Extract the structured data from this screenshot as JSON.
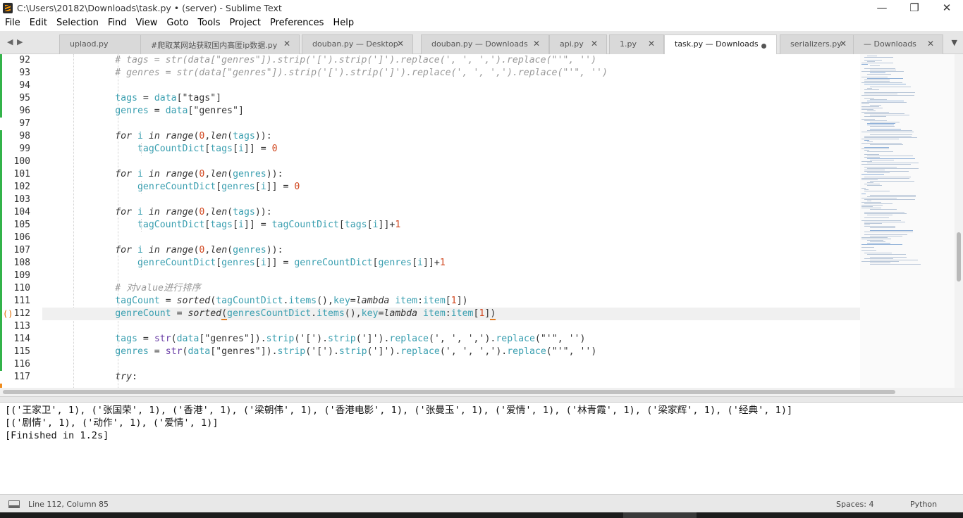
{
  "window": {
    "title": "C:\\Users\\20182\\Downloads\\task.py • (server) - Sublime Text",
    "min_icon": "minimize-icon",
    "max_icon": "maximize-icon",
    "close_icon": "close-icon"
  },
  "menu": [
    "File",
    "Edit",
    "Selection",
    "Find",
    "View",
    "Goto",
    "Tools",
    "Project",
    "Preferences",
    "Help"
  ],
  "tabs": [
    {
      "label": "uplaod.py",
      "active": false
    },
    {
      "label": "#爬取某网站获取国内高匿ip数据.py",
      "active": false
    },
    {
      "label": "douban.py — Desktop",
      "active": false
    },
    {
      "label": "douban.py — Downloads",
      "active": false
    },
    {
      "label": "api.py",
      "active": false
    },
    {
      "label": "1.py",
      "active": false
    },
    {
      "label": "task.py — Downloads",
      "active": true
    },
    {
      "label": "serializers.py",
      "active": false
    },
    {
      "label": "— Downloads",
      "active": false
    }
  ],
  "editor": {
    "line_numbers": [
      "92",
      "93",
      "94",
      "95",
      "96",
      "97",
      "98",
      "99",
      "100",
      "101",
      "102",
      "103",
      "104",
      "105",
      "106",
      "107",
      "108",
      "109",
      "110",
      "111",
      "112",
      "113",
      "114",
      "115",
      "116",
      "117"
    ],
    "current_line": "112",
    "paren_marker": "()"
  },
  "output": {
    "lines": [
      "[('王家卫', 1), ('张国荣', 1), ('香港', 1), ('梁朝伟', 1), ('香港电影', 1), ('张曼玉', 1), ('爱情', 1), ('林青霞', 1), ('梁家辉', 1), ('经典', 1)]",
      "[('剧情', 1), ('动作', 1), ('爱情', 1)]",
      "[Finished in 1.2s]"
    ]
  },
  "status": {
    "position": "Line 112, Column 85",
    "spaces": "Spaces: 4",
    "syntax": "Python"
  },
  "colors": {
    "diff_added": "#33b34a",
    "diff_modified": "#f08c1e",
    "variable": "#3a9fb0",
    "number": "#d0461e",
    "identifier": "#6a3ea6",
    "comment": "#999999"
  }
}
